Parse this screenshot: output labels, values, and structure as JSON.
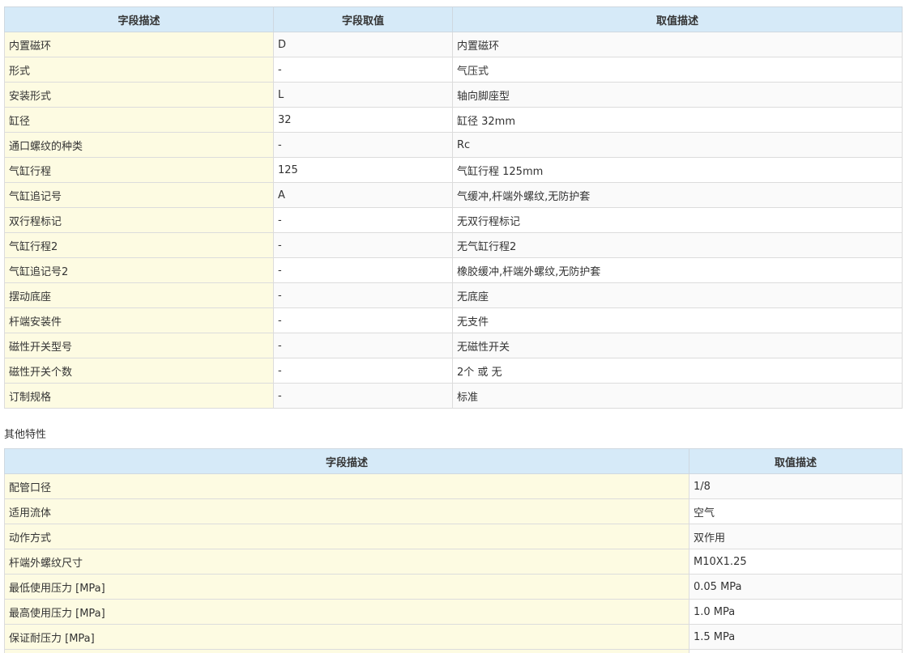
{
  "spec_table": {
    "headers": [
      "字段描述",
      "字段取值",
      "取值描述"
    ],
    "rows": [
      [
        "内置磁环",
        "D",
        "内置磁环"
      ],
      [
        "形式",
        "-",
        "气压式"
      ],
      [
        "安装形式",
        "L",
        "轴向脚座型"
      ],
      [
        "缸径",
        "32",
        "缸径 32mm"
      ],
      [
        "通口螺纹的种类",
        "-",
        "Rc"
      ],
      [
        "气缸行程",
        "125",
        "气缸行程 125mm"
      ],
      [
        "气缸追记号",
        "A",
        "气缓冲,杆端外螺纹,无防护套"
      ],
      [
        "双行程标记",
        "-",
        "无双行程标记"
      ],
      [
        "气缸行程2",
        "-",
        "无气缸行程2"
      ],
      [
        "气缸追记号2",
        "-",
        "橡胶缓冲,杆端外螺纹,无防护套"
      ],
      [
        "摆动底座",
        "-",
        "无底座"
      ],
      [
        "杆端安装件",
        "-",
        "无支件"
      ],
      [
        "磁性开关型号",
        "-",
        "无磁性开关"
      ],
      [
        "磁性开关个数",
        "-",
        "2个 或 无"
      ],
      [
        "订制规格",
        "-",
        "标准"
      ]
    ]
  },
  "other_section": {
    "title": "其他特性",
    "headers": [
      "字段描述",
      "取值描述"
    ],
    "rows": [
      [
        "配管口径",
        "1/8"
      ],
      [
        "适用流体",
        "空气"
      ],
      [
        "动作方式",
        "双作用"
      ],
      [
        "杆端外螺纹尺寸",
        "M10X1.25"
      ],
      [
        "最低使用压力 [MPa]",
        "0.05 MPa"
      ],
      [
        "最高使用压力 [MPa]",
        "1.0 MPa"
      ],
      [
        "保证耐压力 [MPa]",
        "1.5 MPa"
      ],
      [
        "",
        ""
      ]
    ]
  },
  "colors": {
    "header_bg": "#d6eaf8",
    "field_cell_bg": "#fdfbe2",
    "border": "#dcdcdc"
  }
}
